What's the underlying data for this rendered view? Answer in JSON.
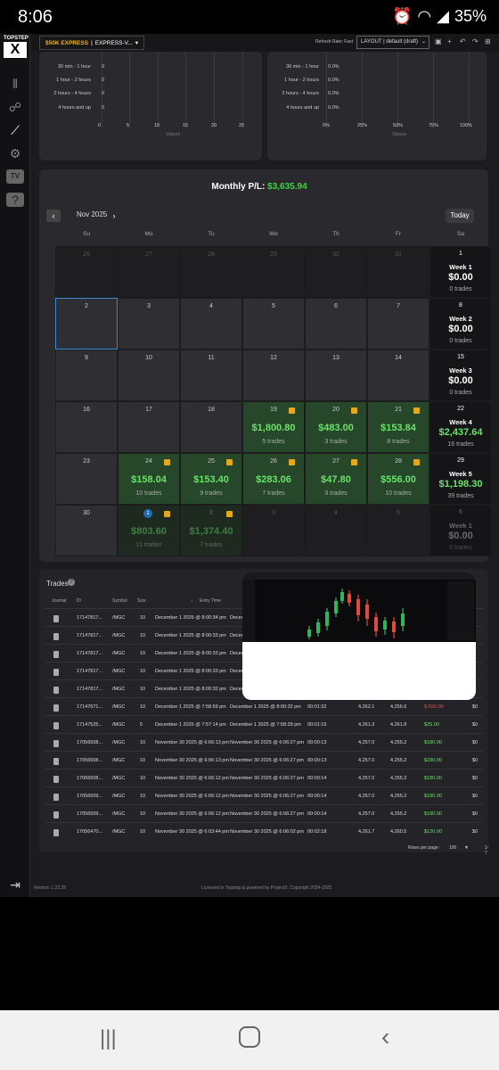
{
  "status": {
    "time": "8:06",
    "battery": "35%"
  },
  "logo": {
    "top": "TOPSTEP",
    "mark": "X"
  },
  "topbar": {
    "account_brand": "$50K EXPRESS",
    "account_sep": "|",
    "account_name": "EXPRESS-V...",
    "refresh": "Refresh Rate: Fast",
    "layout": "LAYOUT | default (draft)"
  },
  "histogram_left": {
    "labels": [
      "30 min - 1 hour",
      "1 hour - 2 hours",
      "2 hours - 4 hours",
      "4 hours and up"
    ],
    "ticks": [
      "0",
      "5",
      "10",
      "15",
      "20",
      "25"
    ],
    "xlabel": "Values",
    "zero": "0"
  },
  "histogram_right": {
    "labels": [
      "30 min - 1 hour",
      "1 hour - 2 hours",
      "2 hours - 4 hours",
      "4 hours and up"
    ],
    "ticks": [
      "0%",
      "25%",
      "50%",
      "75%",
      "100%"
    ],
    "xlabel": "Values",
    "zero": "0.0%"
  },
  "calendar": {
    "title_label": "Monthly P/L:",
    "title_value": "$3,635.94",
    "month": "Nov 2025",
    "prev": "‹",
    "next": "›",
    "today": "Today",
    "days": [
      "Su",
      "Mo",
      "Tu",
      "We",
      "Th",
      "Fr",
      "Sa"
    ],
    "weeks": [
      {
        "days": [
          {
            "n": "26",
            "t": "out"
          },
          {
            "n": "27",
            "t": "out"
          },
          {
            "n": "28",
            "t": "out"
          },
          {
            "n": "29",
            "t": "out"
          },
          {
            "n": "30",
            "t": "out"
          },
          {
            "n": "31",
            "t": "out"
          }
        ],
        "sat": {
          "n": "1",
          "label": "Week 1",
          "amt": "$0.00",
          "tr": "0 trades",
          "g": false
        }
      },
      {
        "days": [
          {
            "n": "2",
            "t": "sel"
          },
          {
            "n": "3"
          },
          {
            "n": "4"
          },
          {
            "n": "5"
          },
          {
            "n": "6"
          },
          {
            "n": "7"
          }
        ],
        "sat": {
          "n": "8",
          "label": "Week 2",
          "amt": "$0.00",
          "tr": "0 trades",
          "g": false
        }
      },
      {
        "days": [
          {
            "n": "9"
          },
          {
            "n": "10"
          },
          {
            "n": "11"
          },
          {
            "n": "12"
          },
          {
            "n": "13"
          },
          {
            "n": "14"
          }
        ],
        "sat": {
          "n": "15",
          "label": "Week 3",
          "amt": "$0.00",
          "tr": "0 trades",
          "g": false
        }
      },
      {
        "days": [
          {
            "n": "16"
          },
          {
            "n": "17"
          },
          {
            "n": "18"
          },
          {
            "n": "19",
            "t": "win",
            "amt": "$1,800.80",
            "tr": "5 trades"
          },
          {
            "n": "20",
            "t": "win",
            "amt": "$483.00",
            "tr": "3 trades"
          },
          {
            "n": "21",
            "t": "win",
            "amt": "$153.84",
            "tr": "8 trades"
          }
        ],
        "sat": {
          "n": "22",
          "label": "Week 4",
          "amt": "$2,437.64",
          "tr": "16 trades",
          "g": true
        }
      },
      {
        "days": [
          {
            "n": "23"
          },
          {
            "n": "24",
            "t": "win",
            "amt": "$158.04",
            "tr": "10 trades"
          },
          {
            "n": "25",
            "t": "win",
            "amt": "$153.40",
            "tr": "9 trades"
          },
          {
            "n": "26",
            "t": "win",
            "amt": "$283.06",
            "tr": "7 trades"
          },
          {
            "n": "27",
            "t": "win",
            "amt": "$47.80",
            "tr": "3 trades"
          },
          {
            "n": "28",
            "t": "win",
            "amt": "$556.00",
            "tr": "10 trades"
          }
        ],
        "sat": {
          "n": "29",
          "label": "Week 5",
          "amt": "$1,198.30",
          "tr": "39 trades",
          "g": true
        }
      },
      {
        "days": [
          {
            "n": "30"
          },
          {
            "n": "1",
            "t": "dim",
            "amt": "$803.60",
            "tr": "11 trades",
            "badge": "1"
          },
          {
            "n": "2",
            "t": "dim",
            "amt": "$1,374.40",
            "tr": "7 trades"
          },
          {
            "n": "3",
            "t": "out"
          },
          {
            "n": "4",
            "t": "out"
          },
          {
            "n": "5",
            "t": "out"
          }
        ],
        "sat": {
          "n": "6",
          "label": "Week 1",
          "amt": "$0.00",
          "tr": "0 trades",
          "g": false,
          "dim": true
        }
      }
    ]
  },
  "trades": {
    "title": "Trades",
    "headers": [
      "Journal",
      "ID",
      "Symbol",
      "Size",
      "Entry Time"
    ],
    "rows": [
      {
        "id": "17147817...",
        "sym": "/MGC",
        "size": "10",
        "entry": "December 1 2025 @ 8:00:34 pm",
        "exit": "Decem",
        "dur": "",
        "ep": "",
        "xp": "",
        "pl": "",
        "fee": ""
      },
      {
        "id": "17147817...",
        "sym": "/MGC",
        "size": "10",
        "entry": "December 1 2025 @ 8:00:33 pm",
        "exit": "Decem",
        "dur": "",
        "ep": "",
        "xp": "",
        "pl": "",
        "fee": ""
      },
      {
        "id": "17147817...",
        "sym": "/MGC",
        "size": "10",
        "entry": "December 1 2025 @ 8:00:33 pm",
        "exit": "Decem",
        "dur": "",
        "ep": "",
        "xp": "",
        "pl": "",
        "fee": ""
      },
      {
        "id": "17147817...",
        "sym": "/MGC",
        "size": "10",
        "entry": "December 1 2025 @ 8:00:33 pm",
        "exit": "Decem",
        "dur": "",
        "ep": "",
        "xp": "",
        "pl": "",
        "fee": ""
      },
      {
        "id": "17147817...",
        "sym": "/MGC",
        "size": "10",
        "entry": "December 1 2025 @ 8:00:32 pm",
        "exit": "Decem",
        "dur": "",
        "ep": "",
        "xp": "",
        "pl": "",
        "fee": ""
      },
      {
        "id": "17147671...",
        "sym": "/MGC",
        "size": "10",
        "entry": "December 1 2025 @ 7:58:59 pm",
        "exit": "December 1 2025 @ 8:00:32 pm",
        "dur": "00:01:32",
        "ep": "4,262.1",
        "xp": "4,256.6",
        "pl": "$-550.00",
        "neg": true,
        "fee": "$0"
      },
      {
        "id": "17147525...",
        "sym": "/MGC",
        "size": "5",
        "entry": "December 1 2025 @ 7:57:14 pm",
        "exit": "December 1 2025 @ 7:58:29 pm",
        "dur": "00:01:15",
        "ep": "4,261.3",
        "xp": "4,261.8",
        "pl": "$25.00",
        "fee": "$0"
      },
      {
        "id": "17056508...",
        "sym": "/MGC",
        "size": "10",
        "entry": "November 30 2025 @ 6:06:13 pm",
        "exit": "November 30 2025 @ 6:06:27 pm",
        "dur": "00:00:13",
        "ep": "4,257.0",
        "xp": "4,255.2",
        "pl": "$180.00",
        "fee": "$0"
      },
      {
        "id": "17056508...",
        "sym": "/MGC",
        "size": "10",
        "entry": "November 30 2025 @ 6:06:13 pm",
        "exit": "November 30 2025 @ 6:06:27 pm",
        "dur": "00:00:13",
        "ep": "4,257.0",
        "xp": "4,255.2",
        "pl": "$180.00",
        "fee": "$0"
      },
      {
        "id": "17056508...",
        "sym": "/MGC",
        "size": "10",
        "entry": "November 30 2025 @ 6:06:12 pm",
        "exit": "November 30 2025 @ 6:06:27 pm",
        "dur": "00:00:14",
        "ep": "4,257.0",
        "xp": "4,255.2",
        "pl": "$180.00",
        "fee": "$0"
      },
      {
        "id": "17056509...",
        "sym": "/MGC",
        "size": "10",
        "entry": "November 30 2025 @ 6:06:12 pm",
        "exit": "November 30 2025 @ 6:06:27 pm",
        "dur": "00:00:14",
        "ep": "4,257.0",
        "xp": "4,255.2",
        "pl": "$180.00",
        "fee": "$0"
      },
      {
        "id": "17056509...",
        "sym": "/MGC",
        "size": "10",
        "entry": "November 30 2025 @ 6:06:12 pm",
        "exit": "November 30 2025 @ 6:06:27 pm",
        "dur": "00:00:14",
        "ep": "4,257.0",
        "xp": "4,255.2",
        "pl": "$180.00",
        "fee": "$0"
      },
      {
        "id": "17056470...",
        "sym": "/MGC",
        "size": "10",
        "entry": "November 30 2025 @ 6:03:44 pm",
        "exit": "November 30 2025 @ 6:06:02 pm",
        "dur": "00:02:18",
        "ep": "4,261.7",
        "xp": "4,260.5",
        "pl": "$120.00",
        "fee": "$0"
      }
    ],
    "rows_per_page_label": "Rows per page:",
    "rows_per_page": "100",
    "range": "1-7"
  },
  "footer": {
    "version": "Version: 1.22.25",
    "license": "Licensed to Topstep & powered by ProjectX. Copyright 2024-2025"
  },
  "colors": {
    "positive": "#6be06b",
    "negative": "#e05050",
    "accent": "#f5b400"
  }
}
